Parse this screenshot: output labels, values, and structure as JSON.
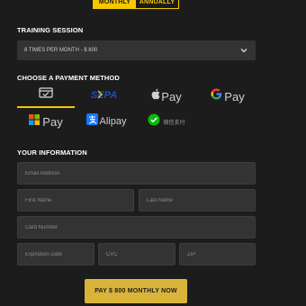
{
  "billing_toggle": {
    "monthly": "MONTHLY",
    "annually": "ANNUALLY"
  },
  "training": {
    "title": "TRAINING SESSION",
    "selected": "8 TIMES PER MONTH - $ 800"
  },
  "payment": {
    "title": "CHOOSE A PAYMENT METHOD",
    "methods": [
      {
        "name": "card",
        "label": ""
      },
      {
        "name": "sepa",
        "label": "SEPA"
      },
      {
        "name": "apple-pay",
        "label": "Pay"
      },
      {
        "name": "google-pay",
        "label": "Pay"
      },
      {
        "name": "microsoft-pay",
        "label": "Pay"
      },
      {
        "name": "alipay",
        "label": "Alipay"
      },
      {
        "name": "wechat-pay",
        "label": "微信支付"
      }
    ]
  },
  "info": {
    "title": "YOUR INFORMATION",
    "email_placeholder": "Email Address",
    "first_name_placeholder": "First Name",
    "last_name_placeholder": "Last Name",
    "card_number_placeholder": "Card Number",
    "expiration_placeholder": "Expiration Date",
    "cvc_placeholder": "CVC",
    "zip_placeholder": "ZIP"
  },
  "pay_button": "PAY $ 800 MONTHLY NOW",
  "colors": {
    "accent": "#f5c800",
    "button": "#d9b43a",
    "background": "#1c1c1c",
    "field": "#333333"
  }
}
